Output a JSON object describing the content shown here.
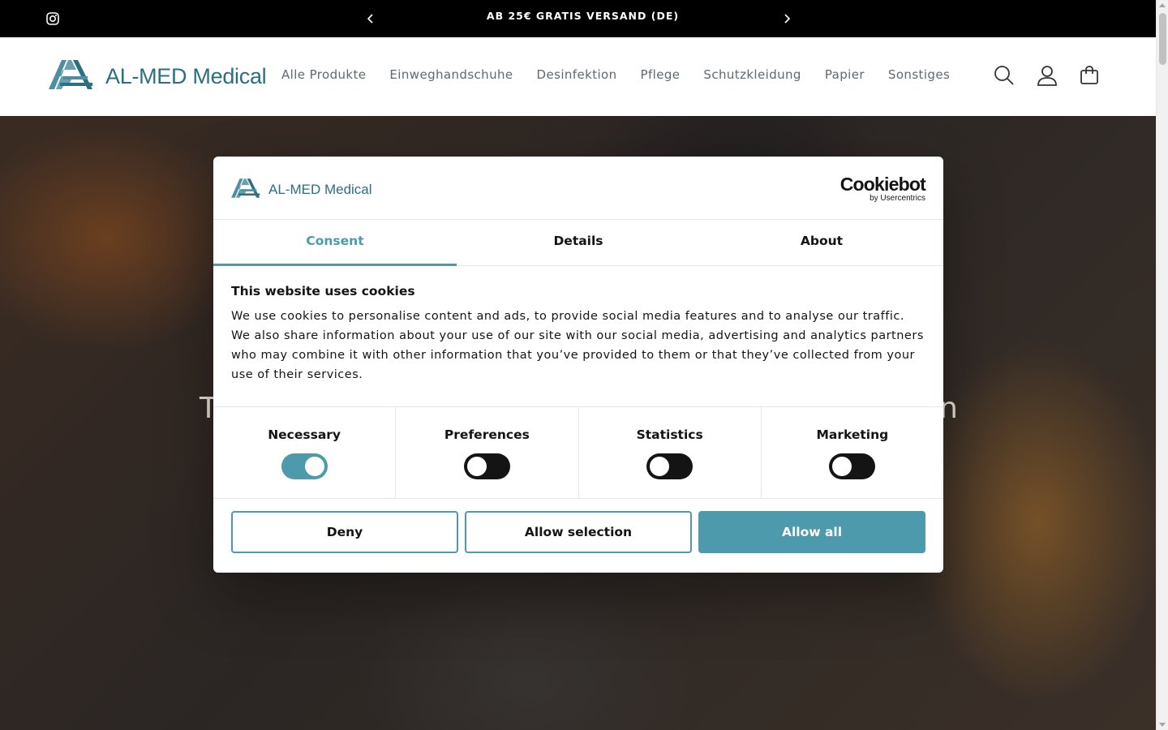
{
  "announcement": {
    "text": "AB 25€ GRATIS VERSAND (DE)"
  },
  "header": {
    "brand": "AL-MED Medical",
    "nav": [
      "Alle Produkte",
      "Einweghandschuhe",
      "Desinfektion",
      "Pflege",
      "Schutzkleidung",
      "Papier",
      "Sonstiges"
    ]
  },
  "hero": {
    "heading_left_fragment": "T",
    "heading_right_fragment": "n"
  },
  "cookie_dialog": {
    "brand": "AL-MED Medical",
    "vendor": "Cookiebot",
    "vendor_sub": "by Usercentrics",
    "tabs": [
      "Consent",
      "Details",
      "About"
    ],
    "active_tab": "Consent",
    "title": "This website uses cookies",
    "text": "We use cookies to personalise content and ads, to provide social media features and to analyse our traffic. We also share information about your use of our site with our social media, advertising and analytics partners who may combine it with other information that you’ve provided to them or that they’ve collected from your use of their services.",
    "categories": [
      {
        "label": "Necessary",
        "enabled": true
      },
      {
        "label": "Preferences",
        "enabled": false
      },
      {
        "label": "Statistics",
        "enabled": false
      },
      {
        "label": "Marketing",
        "enabled": false
      }
    ],
    "buttons": {
      "deny": "Deny",
      "allow_selection": "Allow selection",
      "allow_all": "Allow all"
    },
    "accent_color": "#4d9aac"
  }
}
